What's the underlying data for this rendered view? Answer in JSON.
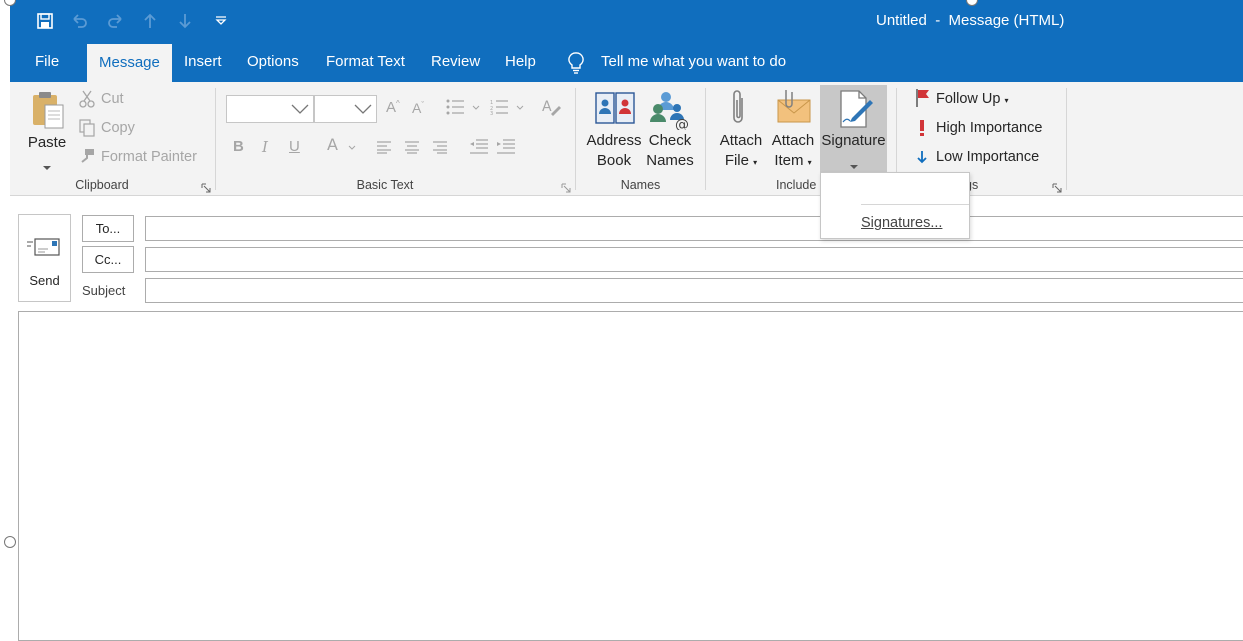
{
  "window": {
    "title": "Untitled  -  Message (HTML)"
  },
  "quick_access": [
    "save-icon",
    "undo-icon",
    "redo-icon",
    "up-arrow-icon",
    "down-arrow-icon",
    "customize-qat-icon"
  ],
  "tabs": [
    {
      "label": "File",
      "active": false
    },
    {
      "label": "Message",
      "active": true
    },
    {
      "label": "Insert",
      "active": false
    },
    {
      "label": "Options",
      "active": false
    },
    {
      "label": "Format Text",
      "active": false
    },
    {
      "label": "Review",
      "active": false
    },
    {
      "label": "Help",
      "active": false
    }
  ],
  "tell_me": "Tell me what you want to do",
  "ribbon": {
    "clipboard": {
      "label": "Clipboard",
      "paste": "Paste",
      "cut": "Cut",
      "copy": "Copy",
      "format_painter": "Format Painter"
    },
    "basic_text": {
      "label": "Basic Text",
      "font_name": "",
      "font_size": ""
    },
    "names": {
      "label": "Names",
      "address_book_1": "Address",
      "address_book_2": "Book",
      "check_names_1": "Check",
      "check_names_2": "Names"
    },
    "include": {
      "label": "Include",
      "attach_file_1": "Attach",
      "attach_file_2": "File",
      "attach_item_1": "Attach",
      "attach_item_2": "Item",
      "signature": "Signature"
    },
    "tags": {
      "label": "Tags",
      "follow_up": "Follow Up",
      "high_importance": "High Importance",
      "low_importance": "Low Importance"
    }
  },
  "signature_menu": {
    "item": "Signatures..."
  },
  "compose": {
    "send": "Send",
    "to": "To...",
    "cc": "Cc...",
    "subject": "Subject",
    "to_value": "",
    "cc_value": "",
    "subject_value": ""
  },
  "colors": {
    "accent": "#106ebe",
    "ribbon_bg": "#f3f3f3",
    "highlight": "#c8c8c8",
    "flag": "#d13438",
    "importance_high": "#d13438",
    "importance_low": "#106ebe"
  }
}
